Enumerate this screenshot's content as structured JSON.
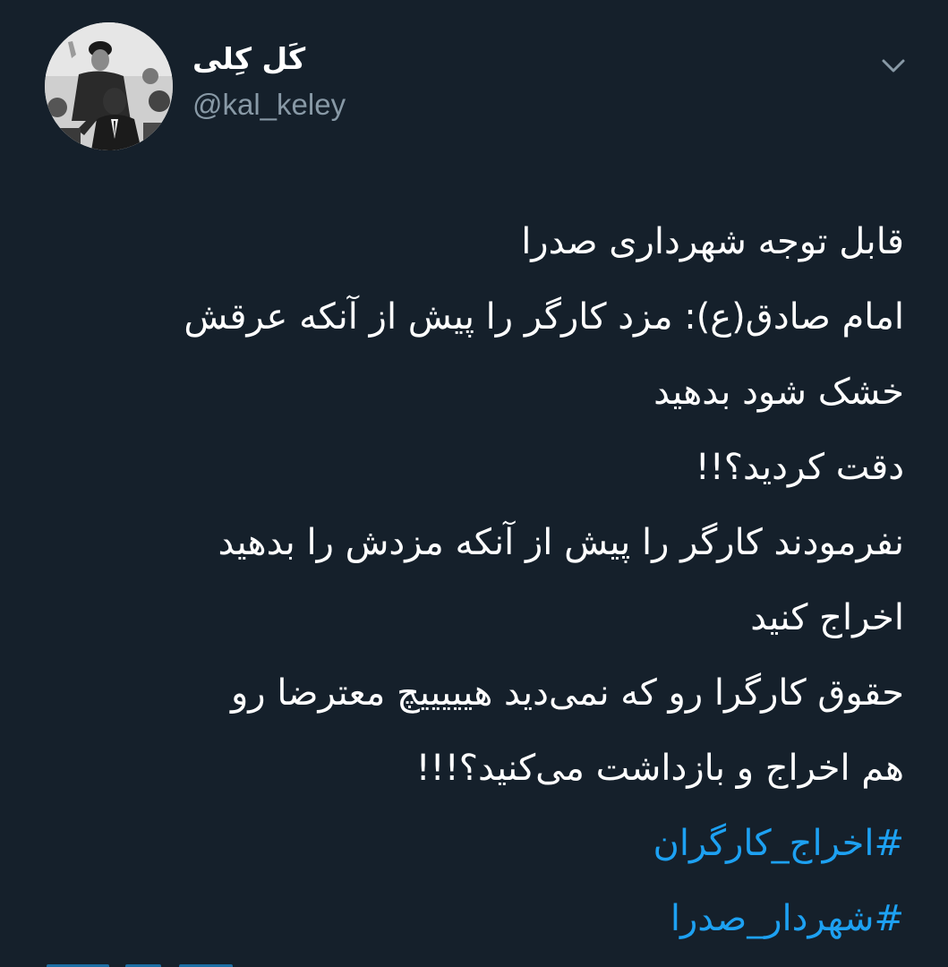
{
  "tweet": {
    "display_name": "کَل کِلی",
    "handle": "@kal_keley",
    "body_lines": [
      "قابل توجه شهرداری صدرا",
      "امام صادق(ع): مزد کارگر را پیش از آنکه عرقش",
      "خشک شود بدهید",
      "دقت کردید؟!!",
      "نفرمودند کارگر را پیش از آنکه مزدش را بدهید",
      "اخراج کنید",
      "حقوق کارگرا رو که نمی‌دید هیییییچ معترضا رو",
      "هم اخراج و بازداشت می‌کنید؟!!!"
    ],
    "hashtags": [
      "#اخراج_کارگران",
      "#شهردار_صدرا"
    ],
    "icons": {
      "avatar": "profile-photo",
      "menu": "chevron-down-icon"
    },
    "colors": {
      "background": "#15202b",
      "text": "#ffffff",
      "secondary": "#8899a6",
      "link": "#1da1f2"
    }
  }
}
